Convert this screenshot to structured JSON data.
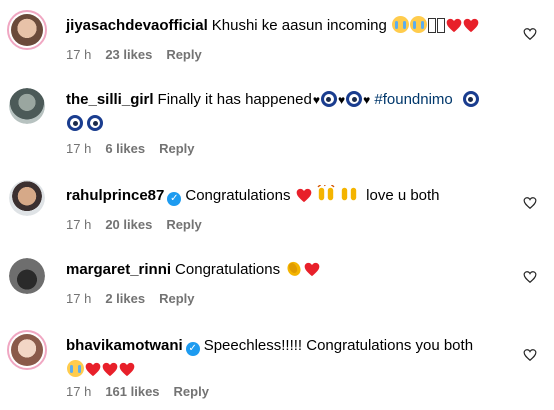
{
  "comments": [
    {
      "username": "jiyasachdevaofficial",
      "text": "Khushi ke aasun incoming",
      "emojis": [
        "crying-face",
        "crying-face",
        "missing-glyph",
        "missing-glyph",
        "red-heart",
        "red-heart"
      ],
      "time": "17 h",
      "likes": "23 likes",
      "reply": "Reply",
      "verified": false
    },
    {
      "username": "the_silli_girl",
      "text": "Finally it has happened",
      "hashtag": "#foundnimo",
      "emojis": [
        "black-heart",
        "nazar-amulet",
        "black-heart",
        "nazar-amulet",
        "black-heart"
      ],
      "emojis_after": [
        "nazar-amulet",
        "nazar-amulet",
        "nazar-amulet"
      ],
      "time": "17 h",
      "likes": "6 likes",
      "reply": "Reply",
      "verified": false
    },
    {
      "username": "rahulprince87",
      "text": "Congratulations",
      "text2": "love u both",
      "emojis": [
        "red-heart",
        "raising-hands",
        "raising-hands"
      ],
      "time": "17 h",
      "likes": "20 likes",
      "reply": "Reply",
      "verified": true
    },
    {
      "username": "margaret_rinni",
      "text": "Congratulations",
      "emojis": [
        "clapping-hands",
        "red-heart"
      ],
      "time": "17 h",
      "likes": "2 likes",
      "reply": "Reply",
      "verified": false
    },
    {
      "username": "bhavikamotwani",
      "text": "Speechless!!!!! Congratulations you both",
      "emojis_after": [
        "crying-face",
        "red-heart",
        "red-heart",
        "red-heart"
      ],
      "time": "17 h",
      "likes": "161 likes",
      "reply": "Reply",
      "verified": true
    }
  ],
  "colors": {
    "meta_text": "#737373",
    "hashtag": "#00376b",
    "verified": "#1d9bf0",
    "heart": "#e8202a"
  },
  "icons": {
    "like": "heart-outline-icon",
    "verified": "verified-badge-icon"
  }
}
